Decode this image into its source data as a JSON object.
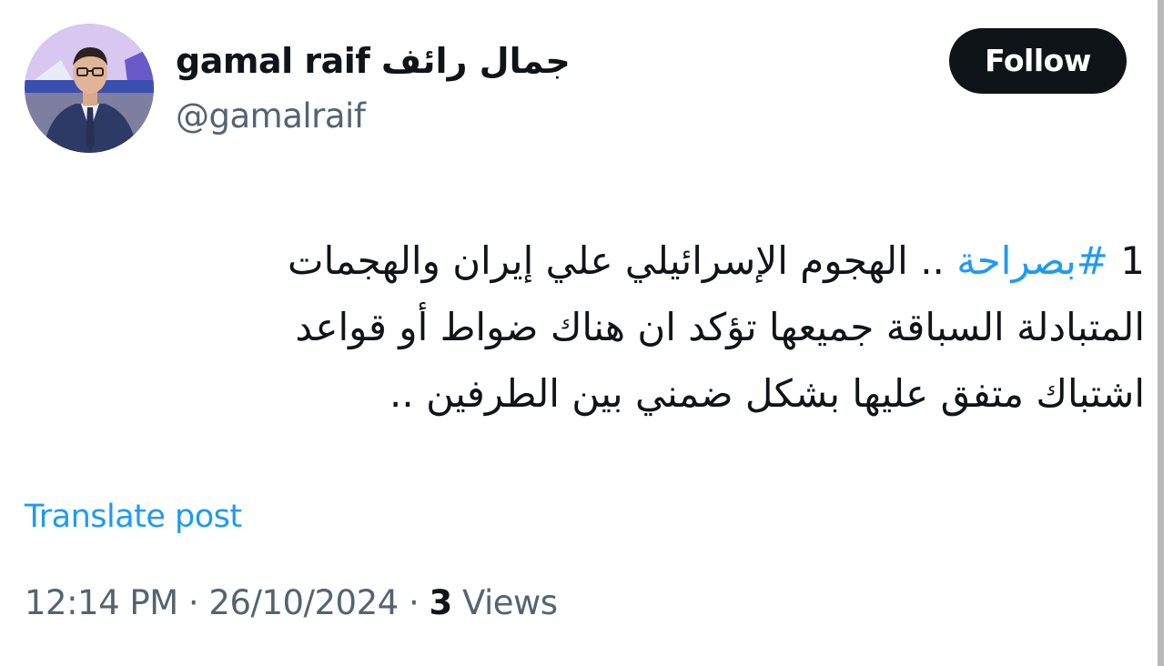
{
  "author": {
    "display_name": "gamal raif جمال رائف",
    "handle": "@gamalraif",
    "follow_label": "Follow"
  },
  "post": {
    "line1_prefix": "1 ",
    "line1_hashtag": "#بصراحة",
    "line1_rest": " .. الهجوم الإسرائيلي علي إيران والهجمات",
    "line2": "المتبادلة السباقة جميعها تؤكد ان هناك ضواط أو قواعد",
    "line3": "اشتباك  متفق عليها بشكل ضمني بين الطرفين .."
  },
  "translate_label": "Translate post",
  "meta": {
    "time": "12:14 PM",
    "separator": " · ",
    "date": "26/10/2024",
    "views_count": "3",
    "views_label": " Views"
  },
  "colors": {
    "text": "#0f1419",
    "secondary": "#536471",
    "link": "#1d9bf0",
    "button_bg": "#0f1419"
  }
}
